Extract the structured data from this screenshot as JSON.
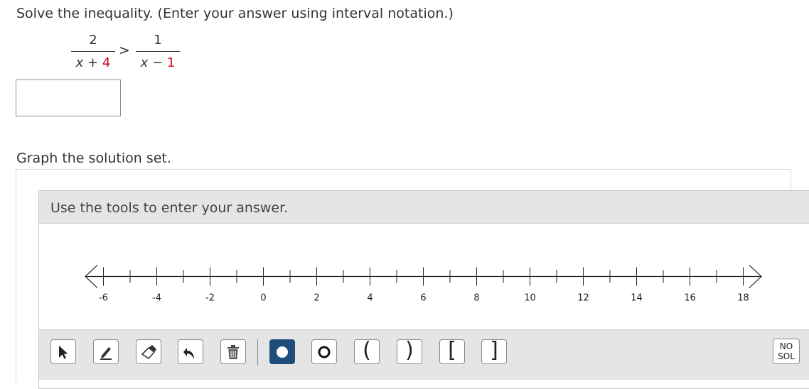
{
  "question": {
    "prompt": "Solve the inequality. (Enter your answer using interval notation.)",
    "left_fraction": {
      "numerator": "2",
      "den_var": "x",
      "den_op": "+",
      "den_const": "4"
    },
    "relation": ">",
    "right_fraction": {
      "numerator": "1",
      "den_var": "x",
      "den_op": "−",
      "den_const": "1"
    },
    "answer_value": ""
  },
  "graph": {
    "label": "Graph the solution set.",
    "panel_title": "Use the tools to enter your answer.",
    "number_line": {
      "min": -7,
      "max": 19,
      "major_step": 2,
      "minor_step": 1,
      "labels": [
        "-6",
        "-4",
        "-2",
        "0",
        "2",
        "4",
        "6",
        "8",
        "10",
        "12",
        "14",
        "16",
        "18"
      ]
    }
  },
  "toolbar": {
    "tools": [
      {
        "name": "pointer-tool",
        "icon": "arrow-pointer-icon"
      },
      {
        "name": "pencil-tool",
        "icon": "pencil-icon"
      },
      {
        "name": "eraser-tool",
        "icon": "eraser-icon"
      },
      {
        "name": "undo-tool",
        "icon": "undo-arrow-icon"
      },
      {
        "name": "delete-tool",
        "icon": "trash-icon"
      },
      {
        "name": "closed-point-tool",
        "icon": "filled-circle-icon",
        "active": true
      },
      {
        "name": "open-point-tool",
        "icon": "open-circle-icon"
      },
      {
        "name": "left-paren-tool",
        "glyph": "("
      },
      {
        "name": "right-paren-tool",
        "glyph": ")"
      },
      {
        "name": "left-bracket-tool",
        "glyph": "["
      },
      {
        "name": "right-bracket-tool",
        "glyph": "]"
      }
    ],
    "no_solution_line1": "NO",
    "no_solution_line2": "SOL",
    "active_color": "#1f4d7a"
  },
  "colors": {
    "accent_red": "#d0021b",
    "panel_bg": "#e5e5e5"
  }
}
